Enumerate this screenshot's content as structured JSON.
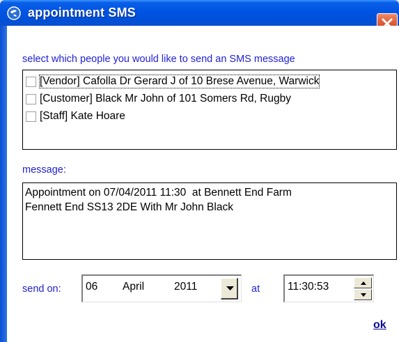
{
  "window": {
    "title": "appointment SMS",
    "title_icon": "app-globe-icon",
    "close_icon": "close-icon"
  },
  "recipients": {
    "label": "select which people you would like to send an SMS message",
    "items": [
      {
        "label": "[Vendor] Cafolla Dr Gerard J  of 10 Brese Avenue, Warwick",
        "checked": false
      },
      {
        "label": "[Customer] Black Mr John of 101 Somers Rd, Rugby",
        "checked": false
      },
      {
        "label": "[Staff] Kate Hoare",
        "checked": false
      }
    ]
  },
  "message": {
    "label": "message:",
    "text": "Appointment on 07/04/2011 11:30  at Bennett End Farm\nFennett End SS13 2DE With Mr John Black"
  },
  "schedule": {
    "send_on_label": "send on:",
    "date_day": "06",
    "date_month": "April",
    "date_year": "2011",
    "at_label": "at",
    "time": "11:30:53"
  },
  "actions": {
    "ok_label": "ok"
  },
  "colors": {
    "title_bar": "#0054e3",
    "label_blue": "#1f1fd6",
    "link": "#0b0b8f",
    "close_red": "#e0603a"
  }
}
